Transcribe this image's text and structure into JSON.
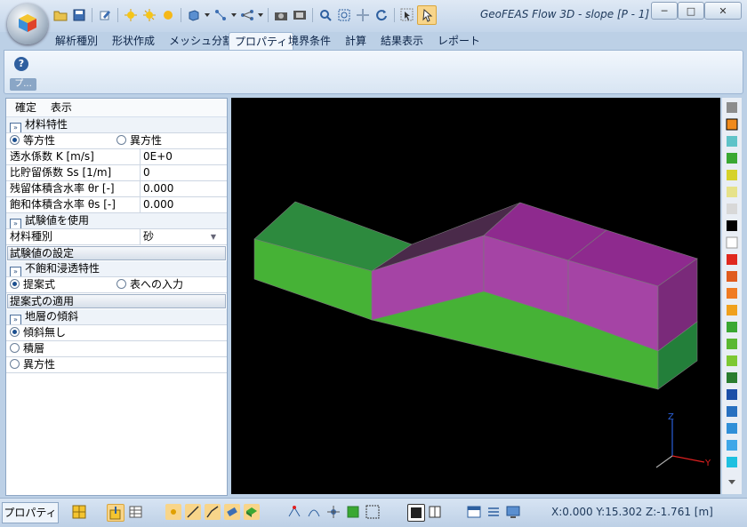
{
  "window": {
    "title": "GeoFEAS Flow 3D - slope [P - 1] ...",
    "minimize": "─",
    "maximize": "□",
    "close": "✕"
  },
  "tabs": [
    "解析種別",
    "形状作成",
    "メッシュ分割",
    "プロパティ",
    "境界条件",
    "計算",
    "結果表示",
    "レポート"
  ],
  "active_tab": "プロパティ",
  "ribbon": {
    "help_icon": "?",
    "group_label": "プ..."
  },
  "panel": {
    "menu": [
      "確定",
      "表示"
    ],
    "material_section": "材料特性",
    "isotropic": "等方性",
    "anisotropic": "異方性",
    "params": [
      {
        "label": "透水係数 K [m/s]",
        "value": "0E+0"
      },
      {
        "label": "比貯留係数 Ss [1/m]",
        "value": "0"
      },
      {
        "label": "残留体積含水率 θr [-]",
        "value": "0.000"
      },
      {
        "label": "飽和体積含水率 θs [-]",
        "value": "0.000"
      }
    ],
    "test_section": "試験値を使用",
    "material_type_label": "材料種別",
    "material_type_value": "砂",
    "test_button": "試験値の設定",
    "unsat_section": "不飽和浸透特性",
    "proposed": "提案式",
    "table_input": "表への入力",
    "apply_button": "提案式の適用",
    "dip_section": "地層の傾斜",
    "dip_options": [
      "傾斜無し",
      "積層",
      "異方性"
    ]
  },
  "statusbar": {
    "tab": "プロパティ",
    "coords": "X:0.000 Y:15.302 Z:-1.761 [m]"
  },
  "axes": {
    "z": "Z",
    "y": "Y"
  },
  "colors": {
    "palette": [
      "#8c8c8c",
      "#f08a1c",
      "#cfcfcf",
      "#5fc3c8",
      "#3aa832",
      "#d6d22a",
      "#e6e28a",
      "#d8d8d8",
      "#000000",
      "#ffffff",
      "#e0281e",
      "#e05b1e",
      "#f07b23",
      "#f0a11e",
      "#3aa832",
      "#5ab832",
      "#7dc832",
      "#2a7d2f",
      "#1c4fa8",
      "#2870c0",
      "#2f8fd8",
      "#3fa7e8",
      "#1ec0e0"
    ]
  }
}
